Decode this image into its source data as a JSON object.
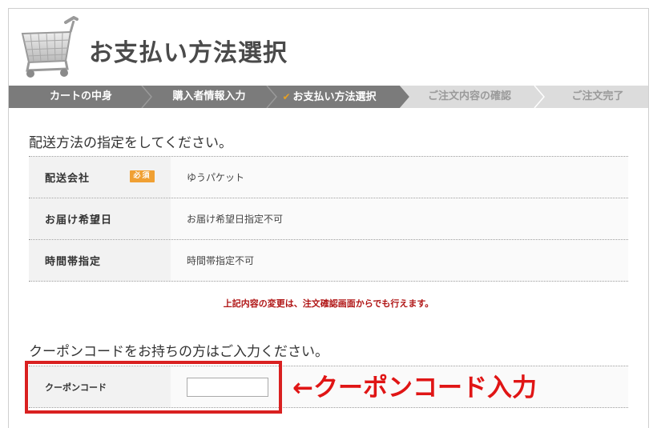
{
  "header": {
    "title": "お支払い方法選択",
    "icon": "shopping-cart-icon"
  },
  "steps": [
    {
      "label": "カートの中身",
      "state": "done"
    },
    {
      "label": "購入者情報入力",
      "state": "done"
    },
    {
      "label": "お支払い方法選択",
      "state": "current"
    },
    {
      "label": "ご注文内容の確認",
      "state": "todo"
    },
    {
      "label": "ご注文完了",
      "state": "todo"
    }
  ],
  "delivery": {
    "heading": "配送方法の指定をしてください。",
    "rows": [
      {
        "label": "配送会社",
        "badge": "必須",
        "value": "ゆうパケット"
      },
      {
        "label": "お届け希望日",
        "value": "お届け希望日指定不可"
      },
      {
        "label": "時間帯指定",
        "value": "時間帯指定不可"
      }
    ],
    "notice": "上記内容の変更は、注文確認画面からでも行えます。"
  },
  "coupon": {
    "heading": "クーポンコードをお持ちの方はご入力ください。",
    "label": "クーポンコード",
    "value": "",
    "annotation": "←クーポンコード入力"
  },
  "colors": {
    "steps_done": "#7b7b7b",
    "steps_todo": "#dcdcdc",
    "badge": "#f0a033",
    "notice": "#b01515",
    "annotation": "#e01515"
  }
}
